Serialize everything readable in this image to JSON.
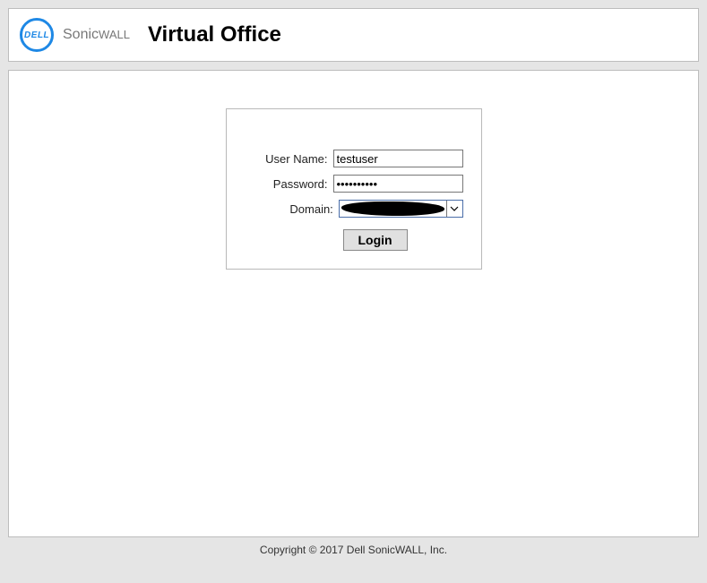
{
  "header": {
    "dell_logo_text": "DELL",
    "sonicwall_brand_prefix": "Sonic",
    "sonicwall_brand_suffix": "WALL",
    "product_title": "Virtual Office"
  },
  "login": {
    "username_label": "User Name:",
    "username_value": "testuser",
    "password_label": "Password:",
    "password_value": "••••••••••",
    "domain_label": "Domain:",
    "domain_value": "",
    "login_button_label": "Login"
  },
  "footer": {
    "copyright": "Copyright © 2017 Dell SonicWALL, Inc."
  }
}
